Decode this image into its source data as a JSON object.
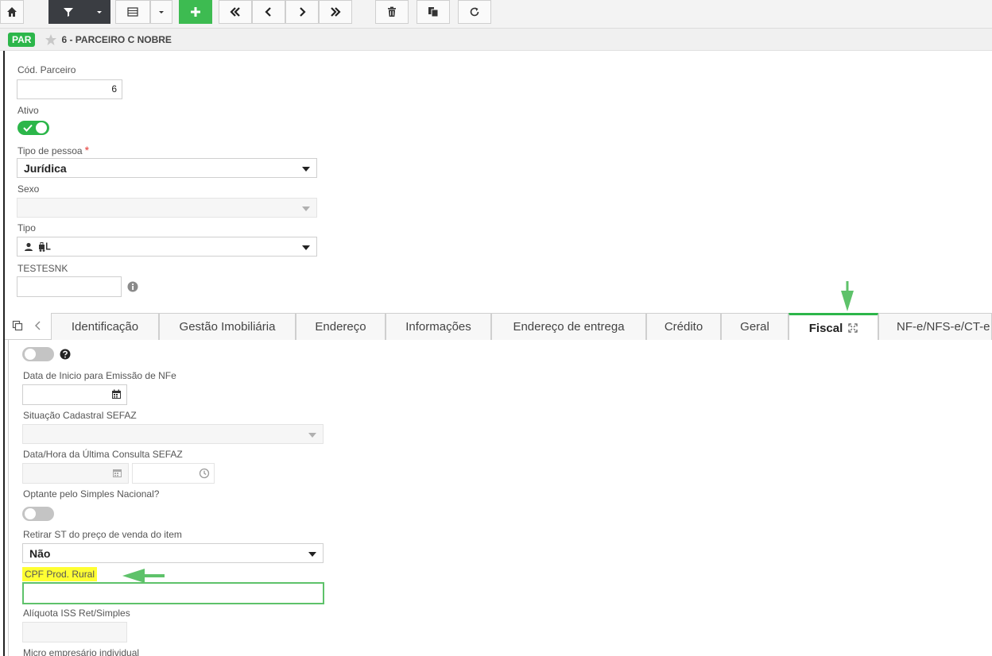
{
  "toolbar": {
    "buttons": [
      "home-icon",
      "filter-icon",
      "chevron-down-icon",
      "grid-icon",
      "chevron-down-icon",
      "plus-icon",
      "first-page-icon",
      "previous-icon",
      "next-icon",
      "last-page-icon",
      "trash-icon",
      "copy-icon",
      "refresh-icon"
    ]
  },
  "record": {
    "badge": "PAR",
    "title": "6 - PARCEIRO C NOBRE"
  },
  "form": {
    "cod_parceiro": {
      "label": "Cód. Parceiro",
      "value": "6"
    },
    "ativo": {
      "label": "Ativo",
      "on": true
    },
    "tipo_pessoa": {
      "label": "Tipo de pessoa",
      "required_mark": "*",
      "value": "Jurídica"
    },
    "sexo": {
      "label": "Sexo",
      "value": ""
    },
    "tipo": {
      "label": "Tipo"
    },
    "testesnk": {
      "label": "TESTESNK",
      "value": ""
    }
  },
  "tabs": [
    {
      "label": "Identificação"
    },
    {
      "label": "Gestão Imobiliária"
    },
    {
      "label": "Endereço"
    },
    {
      "label": "Informações"
    },
    {
      "label": "Endereço de entrega"
    },
    {
      "label": "Crédito"
    },
    {
      "label": "Geral"
    },
    {
      "label": "Fiscal"
    },
    {
      "label": "NF-e/NFS-e/CT-e"
    }
  ],
  "active_tab": "Fiscal",
  "fiscal": {
    "data_inicio_nfe": {
      "label": "Data de Inicio para Emissão de NFe",
      "value": ""
    },
    "situacao_sefaz": {
      "label": "Situação Cadastral SEFAZ",
      "value": ""
    },
    "ultima_consulta": {
      "label": "Data/Hora da Última Consulta SEFAZ",
      "date": "",
      "time": ""
    },
    "simples_nacional": {
      "label": "Optante pelo Simples Nacional?",
      "on": false
    },
    "retirar_st": {
      "label": "Retirar ST do preço de venda do item",
      "value": "Não"
    },
    "cpf_prod_rural": {
      "label": "CPF Prod. Rural",
      "value": ""
    },
    "aliquota_iss": {
      "label": "Alíquota ISS Ret/Simples",
      "value": ""
    },
    "micro_empresario": {
      "label": "Micro empresário individual"
    }
  },
  "colors": {
    "accent_green": "#2cb64a",
    "toolbar_dark": "#3a3d42",
    "highlight_yellow": "#ffff33",
    "annotation_green": "#5ec26a"
  }
}
